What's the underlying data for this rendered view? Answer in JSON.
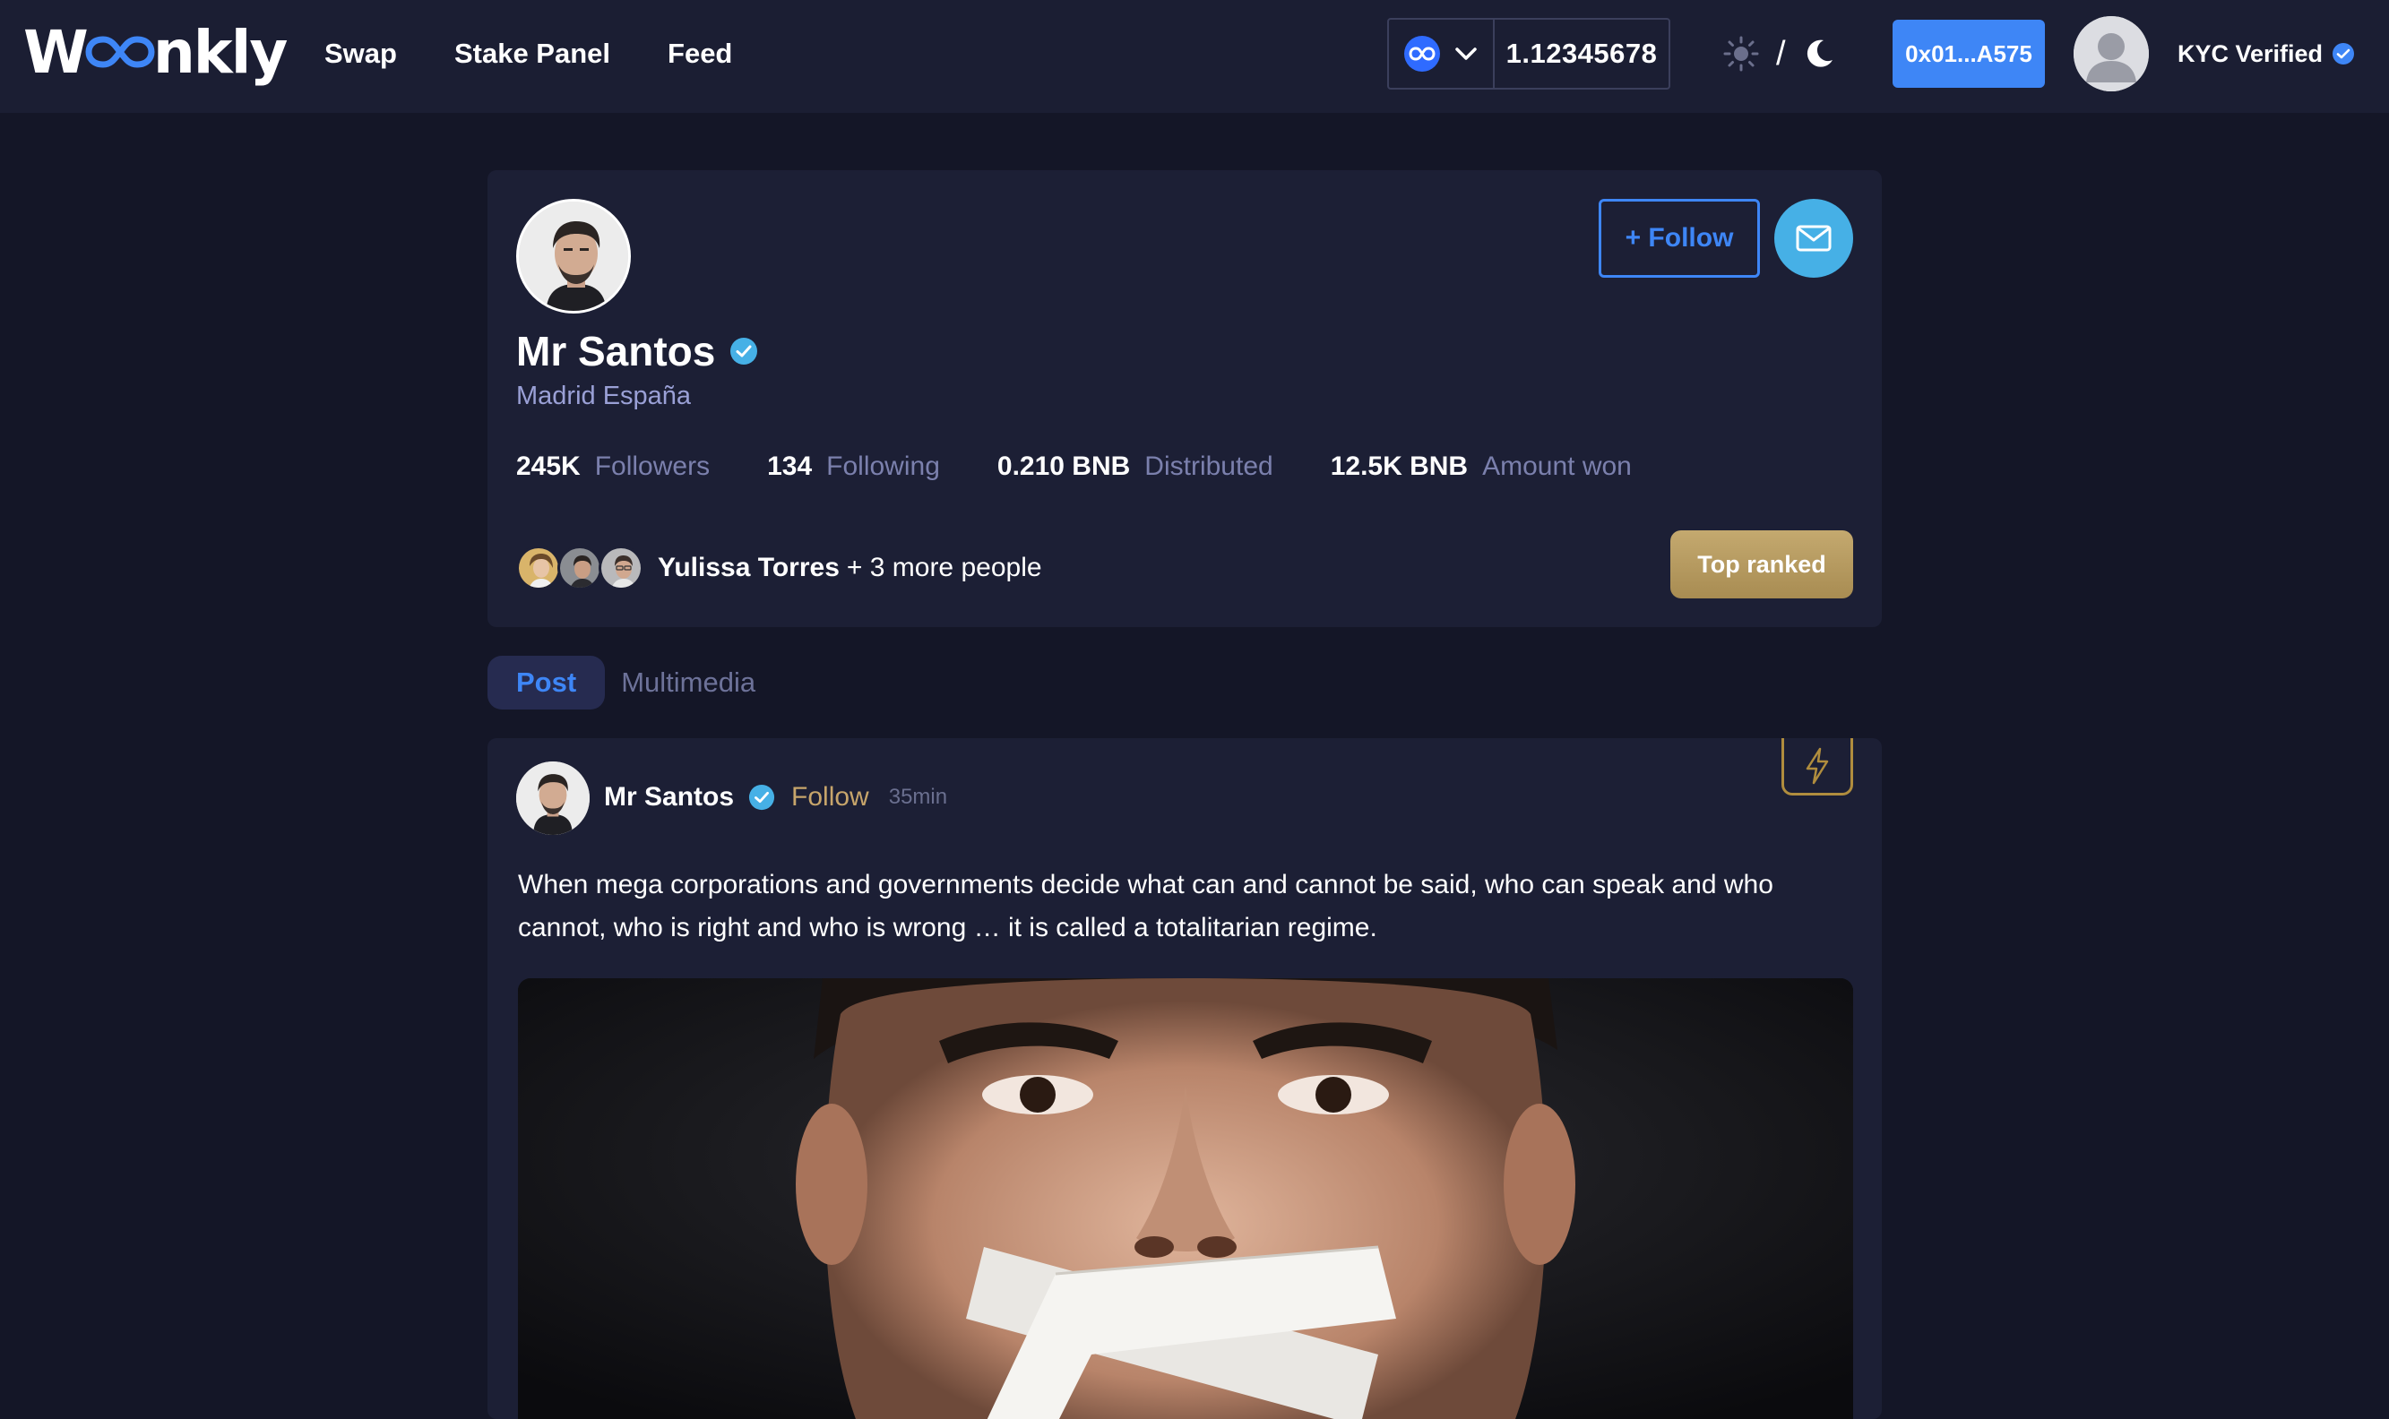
{
  "header": {
    "logo_text_start": "W",
    "logo_text_end": "nkly",
    "nav": [
      {
        "label": "Swap"
      },
      {
        "label": "Stake Panel"
      },
      {
        "label": "Feed"
      }
    ],
    "token_balance": "1.12345678",
    "theme_separator": "/",
    "wallet_address": "0x01...A575",
    "kyc_label": "KYC Verified"
  },
  "profile": {
    "name": "Mr Santos",
    "location": "Madrid España",
    "follow_label": "+ Follow",
    "stats": [
      {
        "value": "245K",
        "label": "Followers"
      },
      {
        "value": "134",
        "label": "Following"
      },
      {
        "value": "0.210 BNB",
        "label": "Distributed"
      },
      {
        "value": "12.5K BNB",
        "label": "Amount won"
      }
    ],
    "followed_by_name": "Yulissa Torres",
    "followed_by_more": "+ 3 more people",
    "badge_label": "Top ranked"
  },
  "tabs": [
    {
      "label": "Post",
      "active": true
    },
    {
      "label": "Multimedia",
      "active": false
    }
  ],
  "post": {
    "author": "Mr Santos",
    "follow_label": "Follow",
    "time": "35min",
    "text": "When mega corporations and governments decide what can and cannot be said, who can speak and who cannot, who is right and who is wrong … it is called a totalitarian regime."
  },
  "colors": {
    "background": "#141627",
    "header": "#1b1e33",
    "card": "#1c1f35",
    "accent_blue": "#3e86f6",
    "gold": "#c7a56b",
    "mail_button": "#46b0e6"
  },
  "icons": [
    "token-infinity-icon",
    "chevron-down-icon",
    "sun-icon",
    "moon-icon",
    "verified-badge-icon",
    "mail-icon",
    "lightning-icon"
  ]
}
